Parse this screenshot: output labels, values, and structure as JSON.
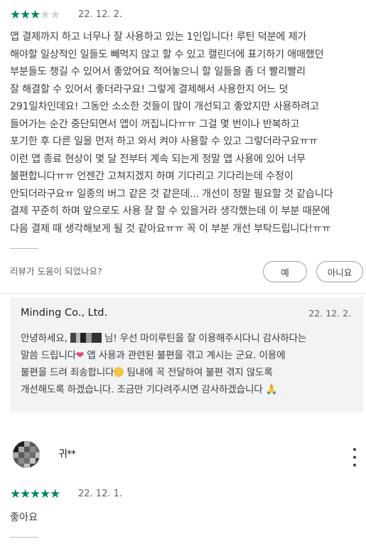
{
  "review1": {
    "rating": 3,
    "max_rating": 5,
    "date": "22. 12. 2.",
    "body": "앱 결제까지 하고 너무나 잘 사용하고 있는 1인입니다! 루틴 덕분에 제가\n해야할 일상적인 일들도 빼먹지 않고 할 수 있고 캘린더에 표기하기 애매했던\n부분들도 챙길 수 있어서 좋았어요 적어놓으니 할 일들을 좀 더 빨리빨리\n잘 해결할 수 있어서 좋더라구요! 그렇게 결제해서 사용한지 어느 덧\n291일차인데요! 그동안 소소한 것들이 많이 개선되고 좋았지만 사용하려고\n들어가는 순간 중단되면서 앱이 꺼집니다ㅠㅠ 그걸 몇 번이나 반복하고\n포기한 후 다른 일을 먼저 하고 와서 켜야 사용할 수 있고 그렇더라구요ㅠㅠ\n이런 앱 종료 현상이 몇 달 전부터 계속 되는게 정말 앱 사용에 있어 너무\n불편합니다ㅠㅠ 언젠간 고쳐지겠지 하며 기다리고 기다리는데 수정이\n안되더라구요ㅠ 일종의 버그 같은 것 같은데... 개선이 정말 필요할 것 같습니다\n결제 꾸준히 하며 앞으로도 사용 잘 할 수 있을거라 생각했는데 이 부분 때문에\n다음 결제 때 생각해보게 될 것 같아요ㅠㅠ 꼭 이 부분 개선 부탁드립니다!ㅠㅠ"
  },
  "helpful": {
    "question": "리뷰가 도움이 되었나요?",
    "yes_label": "예",
    "no_label": "아니요"
  },
  "reply": {
    "developer": "Minding Co., Ltd.",
    "date": "22. 12. 2.",
    "line1_a": "안녕하세요, ",
    "line1_b": " 님! 우선 마이루틴을 잘 이용해주시다니 감사하다는",
    "line2_a": "말씀 드립니다",
    "line2_b": " 앱 사용과 관련된 불편을 겪고 계시는 군요. 이용에",
    "line3_a": "불편을 드려 죄송합니다",
    "line3_b": " 팀내에 꼭 전달하여 불편 겪지 않도록",
    "line4_a": "개선해도록 하겠습니다. 조금만 기다려주시면 감사하겠습니다 ",
    "heart_glyph": "❤",
    "hands_glyph": "🙏"
  },
  "review2": {
    "reviewer_name": "귀**",
    "rating": 5,
    "max_rating": 5,
    "date": "22. 12. 1.",
    "body": "좋아요"
  },
  "colors": {
    "star_on": "#01875f",
    "star_off": "#d2d4d6",
    "reply_bg": "#f1f3f4"
  },
  "icons": {
    "star": "star-icon",
    "more": "more-vert-icon"
  }
}
